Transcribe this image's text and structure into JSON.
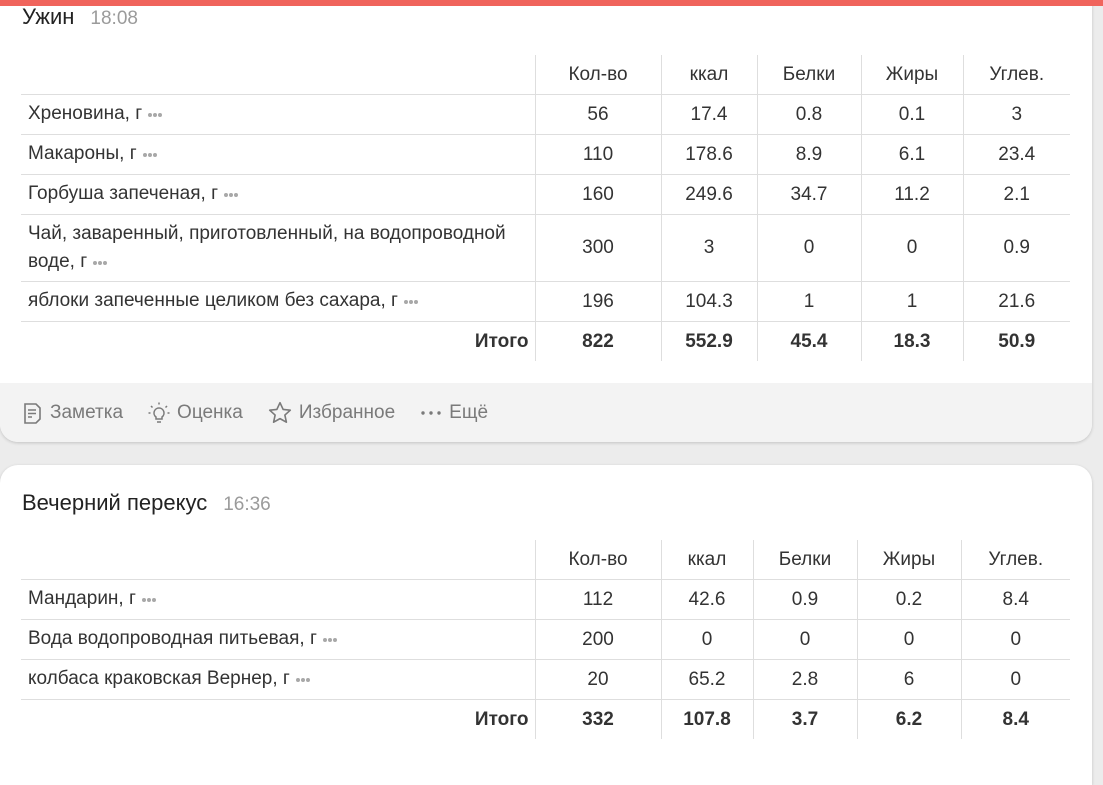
{
  "colors": {
    "accent": "#f0645c",
    "background": "#ececec",
    "footer": "#f3f3f3",
    "muted": "#9b9b9b"
  },
  "table_header": [
    "Кол-во",
    "ккал",
    "Белки",
    "Жиры",
    "Углев."
  ],
  "meals": [
    {
      "title": "Ужин",
      "time": "18:08",
      "items": [
        {
          "name": "Хреновина, г",
          "values": [
            "56",
            "17.4",
            "0.8",
            "0.1",
            "3"
          ]
        },
        {
          "name": "Макароны, г",
          "values": [
            "110",
            "178.6",
            "8.9",
            "6.1",
            "23.4"
          ]
        },
        {
          "name": "Горбуша запеченая, г",
          "values": [
            "160",
            "249.6",
            "34.7",
            "11.2",
            "2.1"
          ]
        },
        {
          "name": "Чай, заваренный, приготовленный, на водопроводной воде, г",
          "values": [
            "300",
            "3",
            "0",
            "0",
            "0.9"
          ]
        },
        {
          "name": "яблоки запеченные целиком без сахара, г",
          "values": [
            "196",
            "104.3",
            "1",
            "1",
            "21.6"
          ]
        }
      ],
      "total_label": "Итого",
      "totals": [
        "822",
        "552.9",
        "45.4",
        "18.3",
        "50.9"
      ],
      "actions": [
        {
          "label": "Заметка",
          "icon": "note-icon"
        },
        {
          "label": "Оценка",
          "icon": "lightbulb-icon"
        },
        {
          "label": "Избранное",
          "icon": "star-icon"
        },
        {
          "label": "Ещё",
          "icon": "more-icon"
        }
      ]
    },
    {
      "title": "Вечерний перекус",
      "time": "16:36",
      "items": [
        {
          "name": "Мандарин, г",
          "values": [
            "112",
            "42.6",
            "0.9",
            "0.2",
            "8.4"
          ]
        },
        {
          "name": "Вода водопроводная питьевая, г",
          "values": [
            "200",
            "0",
            "0",
            "0",
            "0"
          ]
        },
        {
          "name": "колбаса краковская Вернер, г",
          "values": [
            "20",
            "65.2",
            "2.8",
            "6",
            "0"
          ]
        }
      ],
      "total_label": "Итого",
      "totals": [
        "332",
        "107.8",
        "3.7",
        "6.2",
        "8.4"
      ]
    }
  ]
}
